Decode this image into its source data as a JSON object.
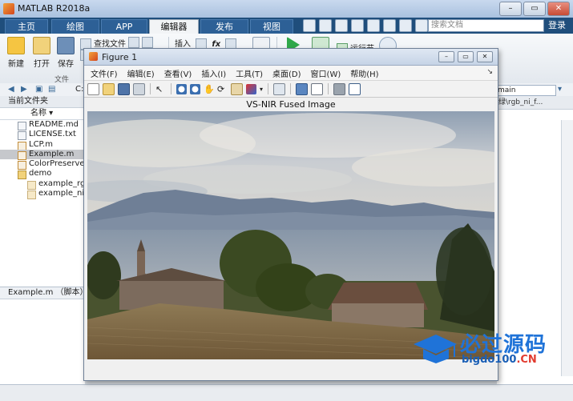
{
  "window": {
    "title": "MATLAB R2018a"
  },
  "tabs": [
    {
      "label": "主页",
      "active": false
    },
    {
      "label": "绘图",
      "active": false
    },
    {
      "label": "APP",
      "active": false
    },
    {
      "label": "编辑器",
      "active": true
    },
    {
      "label": "发布",
      "active": false
    },
    {
      "label": "视图",
      "active": false
    }
  ],
  "search": {
    "placeholder": "搜索文档",
    "button": "登录"
  },
  "ribbon": {
    "new": "新建",
    "open": "打开",
    "save": "保存",
    "find_files": "查找文件",
    "insert": "插入",
    "fx": "fx",
    "run_section": "运行节",
    "file_group": "文件"
  },
  "address": {
    "prefix": "C:",
    "right_path": "main"
  },
  "current_folder": {
    "header": "当前文件夹",
    "column": "名称",
    "files": [
      {
        "name": "README.md",
        "type": "file",
        "selected": false
      },
      {
        "name": "LICENSE.txt",
        "type": "file",
        "selected": false
      },
      {
        "name": "LCP.m",
        "type": "m",
        "selected": false
      },
      {
        "name": "Example.m",
        "type": "m",
        "selected": true
      },
      {
        "name": "ColorPreserveFu",
        "type": "m",
        "selected": false
      },
      {
        "name": "demo",
        "type": "folder",
        "selected": false
      },
      {
        "name": "example_rgb",
        "type": "mat",
        "selected": false
      },
      {
        "name": "example_nir.t",
        "type": "mat",
        "selected": false
      }
    ],
    "details": "Example.m （脚本）"
  },
  "editor": {
    "path": "绿\\rgb_ni_f..."
  },
  "figure": {
    "title": "Figure 1",
    "menu": [
      "文件(F)",
      "编辑(E)",
      "查看(V)",
      "插入(I)",
      "工具(T)",
      "桌面(D)",
      "窗口(W)",
      "帮助(H)"
    ],
    "plot_title": "VS-NIR Fused Image"
  },
  "watermark": {
    "main": "必过源码",
    "sub": "bigdo100",
    "sub_suffix": ".CN"
  },
  "colors": {
    "tab_bar": "#1f4e7c",
    "accent": "#1f73d8"
  }
}
